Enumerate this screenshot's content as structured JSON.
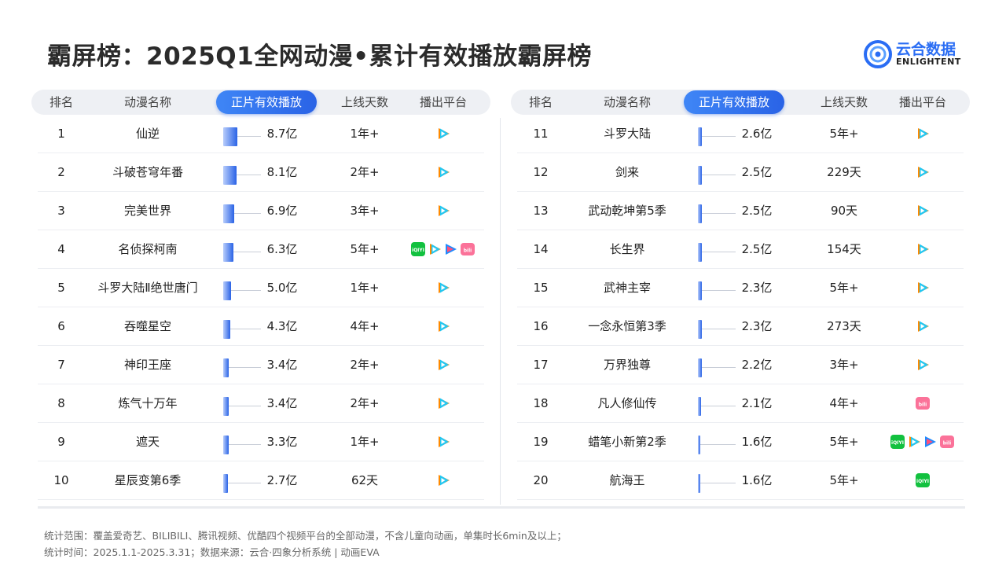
{
  "title": "霸屏榜：2025Q1全网动漫•累计有效播放霸屏榜",
  "brand": {
    "cn": "云合数据",
    "en": "ENLIGHTENT"
  },
  "headers": {
    "rank": "排名",
    "name": "动漫名称",
    "metric": "正片有效播放",
    "days": "上线天数",
    "platform": "播出平台"
  },
  "chart_data": {
    "type": "bar",
    "title": "霸屏榜：2025Q1全网动漫•累计有效播放霸屏榜",
    "metric": "正片有效播放",
    "unit": "亿",
    "rows": [
      {
        "rank": "1",
        "name": "仙逆",
        "value": 8.7,
        "label": "8.7亿",
        "days": "1年+",
        "platforms": [
          "tencent"
        ]
      },
      {
        "rank": "2",
        "name": "斗破苍穹年番",
        "value": 8.1,
        "label": "8.1亿",
        "days": "2年+",
        "platforms": [
          "tencent"
        ]
      },
      {
        "rank": "3",
        "name": "完美世界",
        "value": 6.9,
        "label": "6.9亿",
        "days": "3年+",
        "platforms": [
          "tencent"
        ]
      },
      {
        "rank": "4",
        "name": "名侦探柯南",
        "value": 6.3,
        "label": "6.3亿",
        "days": "5年+",
        "platforms": [
          "iqiyi",
          "tencent",
          "youku",
          "bilibili"
        ]
      },
      {
        "rank": "5",
        "name": "斗罗大陆Ⅱ绝世唐门",
        "value": 5.0,
        "label": "5.0亿",
        "days": "1年+",
        "platforms": [
          "tencent"
        ]
      },
      {
        "rank": "6",
        "name": "吞噬星空",
        "value": 4.3,
        "label": "4.3亿",
        "days": "4年+",
        "platforms": [
          "tencent"
        ]
      },
      {
        "rank": "7",
        "name": "神印王座",
        "value": 3.4,
        "label": "3.4亿",
        "days": "2年+",
        "platforms": [
          "tencent"
        ]
      },
      {
        "rank": "8",
        "name": "炼气十万年",
        "value": 3.4,
        "label": "3.4亿",
        "days": "2年+",
        "platforms": [
          "tencent"
        ]
      },
      {
        "rank": "9",
        "name": "遮天",
        "value": 3.3,
        "label": "3.3亿",
        "days": "1年+",
        "platforms": [
          "tencent"
        ]
      },
      {
        "rank": "10",
        "name": "星辰变第6季",
        "value": 2.7,
        "label": "2.7亿",
        "days": "62天",
        "platforms": [
          "tencent"
        ]
      },
      {
        "rank": "11",
        "name": "斗罗大陆",
        "value": 2.6,
        "label": "2.6亿",
        "days": "5年+",
        "platforms": [
          "tencent"
        ]
      },
      {
        "rank": "12",
        "name": "剑来",
        "value": 2.5,
        "label": "2.5亿",
        "days": "229天",
        "platforms": [
          "tencent"
        ]
      },
      {
        "rank": "13",
        "name": "武动乾坤第5季",
        "value": 2.5,
        "label": "2.5亿",
        "days": "90天",
        "platforms": [
          "tencent"
        ]
      },
      {
        "rank": "14",
        "name": "长生界",
        "value": 2.5,
        "label": "2.5亿",
        "days": "154天",
        "platforms": [
          "tencent"
        ]
      },
      {
        "rank": "15",
        "name": "武神主宰",
        "value": 2.3,
        "label": "2.3亿",
        "days": "5年+",
        "platforms": [
          "tencent"
        ]
      },
      {
        "rank": "16",
        "name": "一念永恒第3季",
        "value": 2.3,
        "label": "2.3亿",
        "days": "273天",
        "platforms": [
          "tencent"
        ]
      },
      {
        "rank": "17",
        "name": "万界独尊",
        "value": 2.2,
        "label": "2.2亿",
        "days": "3年+",
        "platforms": [
          "tencent"
        ]
      },
      {
        "rank": "18",
        "name": "凡人修仙传",
        "value": 2.1,
        "label": "2.1亿",
        "days": "4年+",
        "platforms": [
          "bilibili"
        ]
      },
      {
        "rank": "19",
        "name": "蜡笔小新第2季",
        "value": 1.6,
        "label": "1.6亿",
        "days": "5年+",
        "platforms": [
          "iqiyi",
          "tencent",
          "youku",
          "bilibili"
        ]
      },
      {
        "rank": "20",
        "name": "航海王",
        "value": 1.6,
        "label": "1.6亿",
        "days": "5年+",
        "platforms": [
          "iqiyi"
        ]
      }
    ]
  },
  "icons": {
    "tencent": "tencent-video-icon",
    "iqiyi": "iqiyi-icon",
    "youku": "youku-icon",
    "bilibili": "bilibili-icon"
  },
  "colors": {
    "accent": "#2a63e6",
    "header_bg": "#eef0f4"
  },
  "footer": {
    "line1": "统计范围：覆盖爱奇艺、BILIBILI、腾讯视频、优酷四个视频平台的全部动漫，不含儿童向动画，单集时长6min及以上；",
    "line2": "统计时间：2025.1.1-2025.3.31；数据来源：云合·四象分析系统 | 动画EVA"
  }
}
